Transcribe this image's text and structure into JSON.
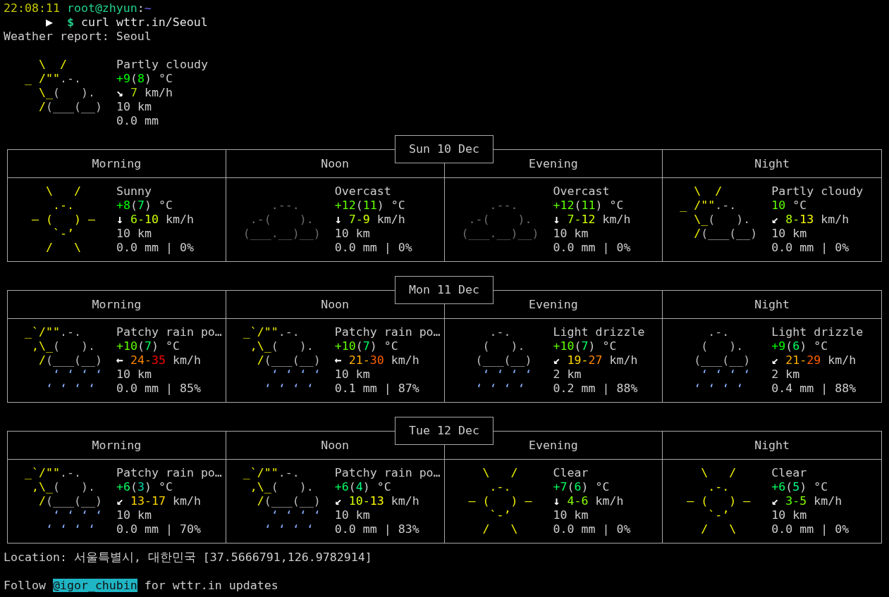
{
  "prompt": {
    "time": "22:08:11",
    "user_host": "root@zhyun",
    "separator": ":",
    "path": "~"
  },
  "command": {
    "marker": "▶",
    "symbol": "$",
    "text": "curl wttr.in/Seoul"
  },
  "report_title": "Weather report: Seoul",
  "current": {
    "art": {
      "kind": "partly_cloudy",
      "lines": [
        [
          {
            "text": "   \\  /",
            "color": "#f0f000"
          }
        ],
        [
          {
            "text": " _ /\"\"",
            "color": "#f0f000"
          },
          {
            "text": ".-.",
            "color": "#bcbcbc"
          }
        ],
        [
          {
            "text": "   \\_",
            "color": "#f0f000"
          },
          {
            "text": "(   ).",
            "color": "#bcbcbc"
          }
        ],
        [
          {
            "text": "   /",
            "color": "#f0f000"
          },
          {
            "text": "(___(__)",
            "color": "#bcbcbc"
          }
        ]
      ]
    },
    "condition": "Partly cloudy",
    "temperature": [
      {
        "text": "+9",
        "color": "#00ff00"
      },
      {
        "text": "("
      },
      {
        "text": "8",
        "color": "#00ff00"
      },
      {
        "text": ") °C"
      }
    ],
    "wind": {
      "arrow": "↘",
      "speed": [
        {
          "text": "7",
          "color": "#afd700"
        }
      ],
      "unit": "km/h"
    },
    "visibility": "10 km",
    "precipitation": "0.0 mm"
  },
  "days": [
    {
      "date": "Sun 10 Dec",
      "periods": [
        {
          "name": "Morning",
          "art": {
            "kind": "sunny",
            "lines": [
              [
                {
                  "text": "    \\   /",
                  "color": "#f0f000"
                }
              ],
              [
                {
                  "text": "     .-.",
                  "color": "#f0f000"
                }
              ],
              [
                {
                  "text": "  ― (   ) ―",
                  "color": "#f0f000"
                }
              ],
              [
                {
                  "text": "     `-’",
                  "color": "#f0f000"
                }
              ],
              [
                {
                  "text": "    /   \\",
                  "color": "#f0f000"
                }
              ]
            ]
          },
          "condition": "Sunny",
          "temperature": [
            {
              "text": "+8",
              "color": "#00ff00"
            },
            {
              "text": "("
            },
            {
              "text": "7",
              "color": "#00ff5f"
            },
            {
              "text": ") °C"
            }
          ],
          "wind": {
            "arrow": "↓",
            "speed": [
              {
                "text": "6-",
                "color": "#afff00"
              },
              {
                "text": "10",
                "color": "#d7ff00"
              }
            ],
            "unit": "km/h"
          },
          "visibility": "10 km",
          "precipitation": "0.0 mm | 0%"
        },
        {
          "name": "Noon",
          "art": {
            "kind": "cloudy",
            "lines": [
              [
                {
                  "text": "     .--.",
                  "color": "#6c6c6c"
                }
              ],
              [
                {
                  "text": "  .-(    ).",
                  "color": "#6c6c6c"
                }
              ],
              [
                {
                  "text": " (___.__)__)",
                  "color": "#6c6c6c"
                }
              ]
            ]
          },
          "condition": "Overcast",
          "temperature": [
            {
              "text": "+12",
              "color": "#5fff00"
            },
            {
              "text": "("
            },
            {
              "text": "11",
              "color": "#5fff00"
            },
            {
              "text": ") °C"
            }
          ],
          "wind": {
            "arrow": "↓",
            "speed": [
              {
                "text": "7-",
                "color": "#afff00"
              },
              {
                "text": "9",
                "color": "#d7ff00"
              }
            ],
            "unit": "km/h"
          },
          "visibility": "10 km",
          "precipitation": "0.0 mm | 0%"
        },
        {
          "name": "Evening",
          "art": {
            "kind": "cloudy",
            "lines": [
              [
                {
                  "text": "     .--.",
                  "color": "#6c6c6c"
                }
              ],
              [
                {
                  "text": "  .-(    ).",
                  "color": "#6c6c6c"
                }
              ],
              [
                {
                  "text": " (___.__)__)",
                  "color": "#6c6c6c"
                }
              ]
            ]
          },
          "condition": "Overcast",
          "temperature": [
            {
              "text": "+12",
              "color": "#5fff00"
            },
            {
              "text": "("
            },
            {
              "text": "11",
              "color": "#5fff00"
            },
            {
              "text": ") °C"
            }
          ],
          "wind": {
            "arrow": "↓",
            "speed": [
              {
                "text": "7-",
                "color": "#afff00"
              },
              {
                "text": "12",
                "color": "#d7ff00"
              }
            ],
            "unit": "km/h"
          },
          "visibility": "10 km",
          "precipitation": "0.0 mm | 0%"
        },
        {
          "name": "Night",
          "art": {
            "kind": "partly_cloudy",
            "lines": [
              [
                {
                  "text": "   \\  /",
                  "color": "#f0f000"
                }
              ],
              [
                {
                  "text": " _ /\"\"",
                  "color": "#f0f000"
                },
                {
                  "text": ".-.",
                  "color": "#bcbcbc"
                }
              ],
              [
                {
                  "text": "   \\_",
                  "color": "#f0f000"
                },
                {
                  "text": "(   ).",
                  "color": "#bcbcbc"
                }
              ],
              [
                {
                  "text": "   /",
                  "color": "#f0f000"
                },
                {
                  "text": "(___(__)",
                  "color": "#bcbcbc"
                }
              ]
            ]
          },
          "condition": "Partly cloudy",
          "temperature": [
            {
              "text": "10",
              "color": "#5fff00"
            },
            {
              "text": " °C"
            }
          ],
          "wind": {
            "arrow": "↙",
            "speed": [
              {
                "text": "8-",
                "color": "#afff00"
              },
              {
                "text": "13",
                "color": "#ffff00"
              }
            ],
            "unit": "km/h"
          },
          "visibility": "10 km",
          "precipitation": "0.0 mm | 0%"
        }
      ]
    },
    {
      "date": "Mon 11 Dec",
      "periods": [
        {
          "name": "Morning",
          "art": {
            "kind": "light_showers",
            "lines": [
              [
                {
                  "text": " _`/\"\"",
                  "color": "#f0f000"
                },
                {
                  "text": ".-.",
                  "color": "#bcbcbc"
                }
              ],
              [
                {
                  "text": "  ,\\_",
                  "color": "#f0f000"
                },
                {
                  "text": "(   ).",
                  "color": "#bcbcbc"
                }
              ],
              [
                {
                  "text": "   /",
                  "color": "#f0f000"
                },
                {
                  "text": "(___(__)",
                  "color": "#bcbcbc"
                }
              ],
              [
                {
                  "text": "     ‘ ‘ ‘ ‘",
                  "color": "#87afff"
                }
              ],
              [
                {
                  "text": "    ‘ ‘ ‘ ‘",
                  "color": "#87afff"
                }
              ]
            ]
          },
          "condition": "Patchy rain po…",
          "temperature": [
            {
              "text": "+10",
              "color": "#5fff00"
            },
            {
              "text": "("
            },
            {
              "text": "7",
              "color": "#00ff5f"
            },
            {
              "text": ") °C"
            }
          ],
          "wind": {
            "arrow": "←",
            "speed": [
              {
                "text": "24-",
                "color": "#ff8700"
              },
              {
                "text": "35",
                "color": "#ff0000"
              }
            ],
            "unit": "km/h"
          },
          "visibility": "10 km",
          "precipitation": "0.0 mm | 85%"
        },
        {
          "name": "Noon",
          "art": {
            "kind": "light_showers",
            "lines": [
              [
                {
                  "text": " _`/\"\"",
                  "color": "#f0f000"
                },
                {
                  "text": ".-.",
                  "color": "#bcbcbc"
                }
              ],
              [
                {
                  "text": "  ,\\_",
                  "color": "#f0f000"
                },
                {
                  "text": "(   ).",
                  "color": "#bcbcbc"
                }
              ],
              [
                {
                  "text": "   /",
                  "color": "#f0f000"
                },
                {
                  "text": "(___(__)",
                  "color": "#bcbcbc"
                }
              ],
              [
                {
                  "text": "     ‘ ‘ ‘ ‘",
                  "color": "#87afff"
                }
              ],
              [
                {
                  "text": "    ‘ ‘ ‘ ‘",
                  "color": "#87afff"
                }
              ]
            ]
          },
          "condition": "Patchy rain po…",
          "temperature": [
            {
              "text": "+10",
              "color": "#5fff00"
            },
            {
              "text": "("
            },
            {
              "text": "7",
              "color": "#00ff5f"
            },
            {
              "text": ") °C"
            }
          ],
          "wind": {
            "arrow": "←",
            "speed": [
              {
                "text": "21-",
                "color": "#ffaf00"
              },
              {
                "text": "30",
                "color": "#ff5f00"
              }
            ],
            "unit": "km/h"
          },
          "visibility": "10 km",
          "precipitation": "0.1 mm | 87%"
        },
        {
          "name": "Evening",
          "art": {
            "kind": "light_rain",
            "lines": [
              [
                {
                  "text": "     .-.",
                  "color": "#bcbcbc"
                }
              ],
              [
                {
                  "text": "    (   ).",
                  "color": "#bcbcbc"
                }
              ],
              [
                {
                  "text": "   (___(__)",
                  "color": "#bcbcbc"
                }
              ],
              [
                {
                  "text": "    ‘ ‘ ‘ ‘",
                  "color": "#87afff"
                }
              ],
              [
                {
                  "text": "   ‘ ‘ ‘ ‘",
                  "color": "#87afff"
                }
              ]
            ]
          },
          "condition": "Light drizzle",
          "temperature": [
            {
              "text": "+10",
              "color": "#5fff00"
            },
            {
              "text": "("
            },
            {
              "text": "7",
              "color": "#00ff5f"
            },
            {
              "text": ") °C"
            }
          ],
          "wind": {
            "arrow": "↙",
            "speed": [
              {
                "text": "19-",
                "color": "#ffd700"
              },
              {
                "text": "27",
                "color": "#ff8700"
              }
            ],
            "unit": "km/h"
          },
          "visibility": "2 km",
          "precipitation": "0.2 mm | 88%"
        },
        {
          "name": "Night",
          "art": {
            "kind": "light_rain",
            "lines": [
              [
                {
                  "text": "     .-.",
                  "color": "#bcbcbc"
                }
              ],
              [
                {
                  "text": "    (   ).",
                  "color": "#bcbcbc"
                }
              ],
              [
                {
                  "text": "   (___(__)",
                  "color": "#bcbcbc"
                }
              ],
              [
                {
                  "text": "    ‘ ‘ ‘ ‘",
                  "color": "#87afff"
                }
              ],
              [
                {
                  "text": "   ‘ ‘ ‘ ‘",
                  "color": "#87afff"
                }
              ]
            ]
          },
          "condition": "Light drizzle",
          "temperature": [
            {
              "text": "+9",
              "color": "#00ff00"
            },
            {
              "text": "("
            },
            {
              "text": "6",
              "color": "#00ff5f"
            },
            {
              "text": ") °C"
            }
          ],
          "wind": {
            "arrow": "↙",
            "speed": [
              {
                "text": "21-",
                "color": "#ffaf00"
              },
              {
                "text": "29",
                "color": "#ff5f00"
              }
            ],
            "unit": "km/h"
          },
          "visibility": "2 km",
          "precipitation": "0.4 mm | 88%"
        }
      ]
    },
    {
      "date": "Tue 12 Dec",
      "periods": [
        {
          "name": "Morning",
          "art": {
            "kind": "light_showers",
            "lines": [
              [
                {
                  "text": " _`/\"\"",
                  "color": "#f0f000"
                },
                {
                  "text": ".-.",
                  "color": "#bcbcbc"
                }
              ],
              [
                {
                  "text": "  ,\\_",
                  "color": "#f0f000"
                },
                {
                  "text": "(   ).",
                  "color": "#bcbcbc"
                }
              ],
              [
                {
                  "text": "   /",
                  "color": "#f0f000"
                },
                {
                  "text": "(___(__)",
                  "color": "#bcbcbc"
                }
              ],
              [
                {
                  "text": "     ‘ ‘ ‘ ‘",
                  "color": "#87afff"
                }
              ],
              [
                {
                  "text": "    ‘ ‘ ‘ ‘",
                  "color": "#87afff"
                }
              ]
            ]
          },
          "condition": "Patchy rain po…",
          "temperature": [
            {
              "text": "+6",
              "color": "#00ff5f"
            },
            {
              "text": "("
            },
            {
              "text": "3",
              "color": "#00d7af"
            },
            {
              "text": ") °C"
            }
          ],
          "wind": {
            "arrow": "↙",
            "speed": [
              {
                "text": "13-",
                "color": "#ffd700"
              },
              {
                "text": "17",
                "color": "#ffd700"
              }
            ],
            "unit": "km/h"
          },
          "visibility": "10 km",
          "precipitation": "0.0 mm | 70%"
        },
        {
          "name": "Noon",
          "art": {
            "kind": "light_showers",
            "lines": [
              [
                {
                  "text": " _`/\"\"",
                  "color": "#f0f000"
                },
                {
                  "text": ".-.",
                  "color": "#bcbcbc"
                }
              ],
              [
                {
                  "text": "  ,\\_",
                  "color": "#f0f000"
                },
                {
                  "text": "(   ).",
                  "color": "#bcbcbc"
                }
              ],
              [
                {
                  "text": "   /",
                  "color": "#f0f000"
                },
                {
                  "text": "(___(__)",
                  "color": "#bcbcbc"
                }
              ],
              [
                {
                  "text": "     ‘ ‘ ‘ ‘",
                  "color": "#87afff"
                }
              ],
              [
                {
                  "text": "    ‘ ‘ ‘ ‘",
                  "color": "#87afff"
                }
              ]
            ]
          },
          "condition": "Patchy rain po…",
          "temperature": [
            {
              "text": "+6",
              "color": "#00ff5f"
            },
            {
              "text": "("
            },
            {
              "text": "4",
              "color": "#00ff87"
            },
            {
              "text": ") °C"
            }
          ],
          "wind": {
            "arrow": "↙",
            "speed": [
              {
                "text": "10-",
                "color": "#d7ff00"
              },
              {
                "text": "13",
                "color": "#ffff00"
              }
            ],
            "unit": "km/h"
          },
          "visibility": "10 km",
          "precipitation": "0.0 mm | 83%"
        },
        {
          "name": "Evening",
          "art": {
            "kind": "sunny",
            "lines": [
              [
                {
                  "text": "    \\   /",
                  "color": "#f0f000"
                }
              ],
              [
                {
                  "text": "     .-.",
                  "color": "#f0f000"
                }
              ],
              [
                {
                  "text": "  ― (   ) ―",
                  "color": "#f0f000"
                }
              ],
              [
                {
                  "text": "     `-’",
                  "color": "#f0f000"
                }
              ],
              [
                {
                  "text": "    /   \\",
                  "color": "#f0f000"
                }
              ]
            ]
          },
          "condition": "Clear",
          "temperature": [
            {
              "text": "+7",
              "color": "#00ff5f"
            },
            {
              "text": "("
            },
            {
              "text": "6",
              "color": "#00ff5f"
            },
            {
              "text": ") °C"
            }
          ],
          "wind": {
            "arrow": "↓",
            "speed": [
              {
                "text": "4-",
                "color": "#87ff00"
              },
              {
                "text": "6",
                "color": "#87ff00"
              }
            ],
            "unit": "km/h"
          },
          "visibility": "10 km",
          "precipitation": "0.0 mm | 0%"
        },
        {
          "name": "Night",
          "art": {
            "kind": "sunny",
            "lines": [
              [
                {
                  "text": "    \\   /",
                  "color": "#f0f000"
                }
              ],
              [
                {
                  "text": "     .-.",
                  "color": "#f0f000"
                }
              ],
              [
                {
                  "text": "  ― (   ) ―",
                  "color": "#f0f000"
                }
              ],
              [
                {
                  "text": "     `-’",
                  "color": "#f0f000"
                }
              ],
              [
                {
                  "text": "    /   \\",
                  "color": "#f0f000"
                }
              ]
            ]
          },
          "condition": "Clear",
          "temperature": [
            {
              "text": "+6",
              "color": "#00ff5f"
            },
            {
              "text": "("
            },
            {
              "text": "5",
              "color": "#00ff87"
            },
            {
              "text": ") °C"
            }
          ],
          "wind": {
            "arrow": "↙",
            "speed": [
              {
                "text": "3-",
                "color": "#5fff00"
              },
              {
                "text": "5",
                "color": "#87ff00"
              }
            ],
            "unit": "km/h"
          },
          "visibility": "10 km",
          "precipitation": "0.0 mm | 0%"
        }
      ]
    }
  ],
  "location": "Location: 서울특별시, 대한민국 [37.5666791,126.9782914]",
  "follow": {
    "before": "Follow",
    "handle": "@igor_chubin",
    "after": "for wttr.in updates"
  }
}
